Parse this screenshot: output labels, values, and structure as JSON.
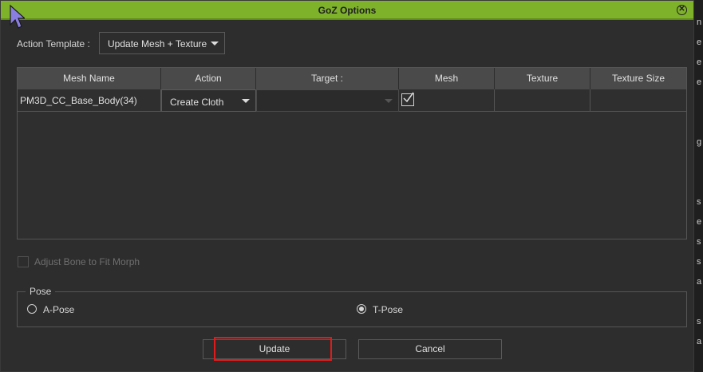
{
  "window": {
    "title": "GoZ Options"
  },
  "action_template": {
    "label": "Action Template :",
    "selected": "Update Mesh + Texture"
  },
  "table": {
    "columns": [
      "Mesh Name",
      "Action",
      "Target :",
      "Mesh",
      "Texture",
      "Texture Size"
    ],
    "rows": [
      {
        "mesh_name": "PM3D_CC_Base_Body(34)",
        "action": "Create Cloth",
        "target": "",
        "mesh_checked": true,
        "texture": "",
        "texture_size": ""
      }
    ]
  },
  "adjust_bone": {
    "label": "Adjust Bone to Fit Morph",
    "checked": false,
    "enabled": false
  },
  "pose": {
    "title": "Pose",
    "options": [
      {
        "label": "A-Pose",
        "selected": false
      },
      {
        "label": "T-Pose",
        "selected": true
      }
    ]
  },
  "buttons": {
    "update": "Update",
    "cancel": "Cancel"
  },
  "background_fragments": [
    "n",
    "e",
    "e",
    "e",
    "g",
    "s",
    "e",
    "s",
    "s",
    "a",
    "s",
    "a"
  ],
  "colors": {
    "titlebar": "#7fb22b",
    "highlight": "#e01b1b",
    "cursor": "#8a7fe0"
  },
  "icons": {
    "close": "close-circle-icon",
    "checkbox": "checkmark-icon",
    "cursor": "mouse-pointer-icon"
  }
}
